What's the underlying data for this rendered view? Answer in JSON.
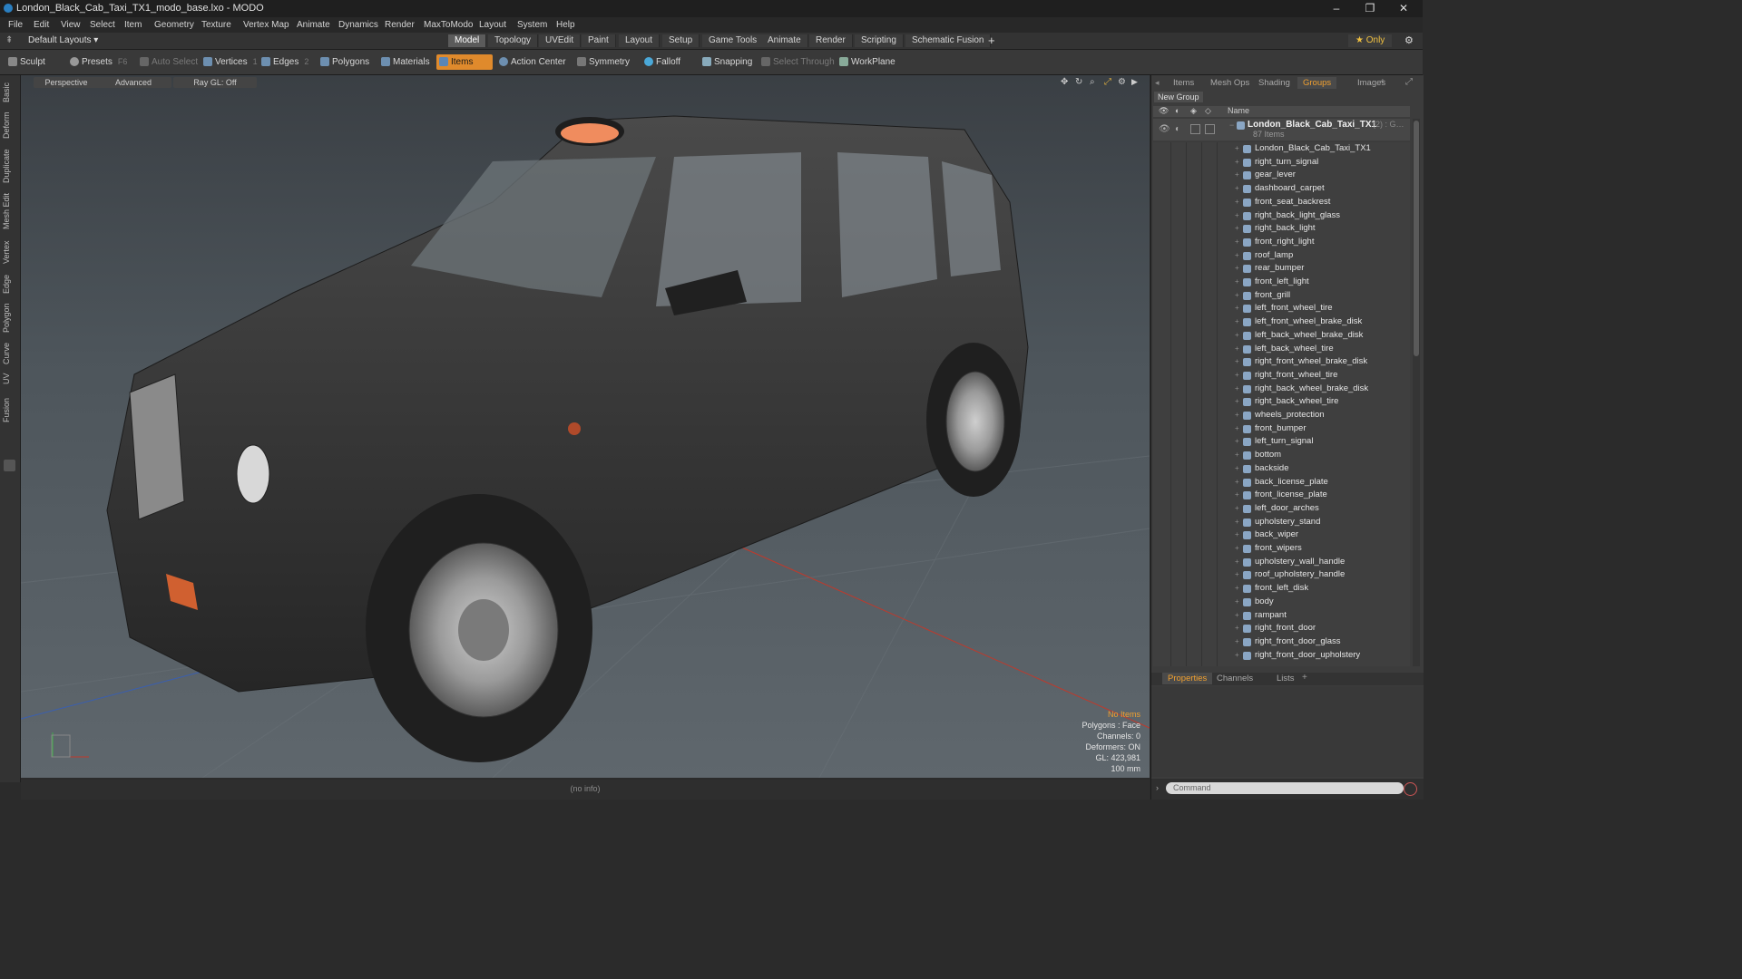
{
  "window": {
    "title": "London_Black_Cab_Taxi_TX1_modo_base.lxo - MODO",
    "controls": [
      "–",
      "❐",
      "✕"
    ]
  },
  "menu": [
    "File",
    "Edit",
    "View",
    "Select",
    "Item",
    "Geometry",
    "Texture",
    "Vertex Map",
    "Animate",
    "Dynamics",
    "Render",
    "MaxToModo",
    "Layout",
    "System",
    "Help"
  ],
  "layout_bar": {
    "layout_select": "Default Layouts ▾",
    "tabs": [
      "Model",
      "Topology",
      "UVEdit",
      "Paint",
      "Layout",
      "Setup",
      "Game Tools",
      "Animate",
      "Render",
      "Scripting",
      "Schematic Fusion"
    ],
    "active_tab": "Model",
    "add": "+",
    "only": "★  Only",
    "gear": "⚙"
  },
  "toolbar": {
    "sculpt": "Sculpt",
    "presets": "Presets",
    "presets_key": "F6",
    "auto_select": "Auto Select",
    "vertices": "Vertices",
    "vertices_count": "1",
    "edges": "Edges",
    "edges_count": "2",
    "polygons": "Polygons",
    "materials": "Materials",
    "items": "Items",
    "action_center": "Action Center",
    "symmetry": "Symmetry",
    "falloff": "Falloff",
    "snapping": "Snapping",
    "select_through": "Select Through",
    "workplane": "WorkPlane"
  },
  "left_tabs": [
    "Basic",
    "Deform",
    "Duplicate",
    "Mesh Edit",
    "Vertex",
    "Edge",
    "Polygon",
    "Curve",
    "UV",
    "Fusion"
  ],
  "viewport": {
    "view": "Perspective",
    "shading": "Advanced",
    "raygl": "Ray GL: Off",
    "hud": {
      "no_items": "No Items",
      "polygons": "Polygons : Face",
      "channels": "Channels: 0",
      "deformers": "Deformers: ON",
      "gl": "GL: 423,981",
      "unit": "100 mm"
    }
  },
  "status": "(no info)",
  "right_panel": {
    "tabs": [
      "Items",
      "Mesh Ops",
      "Shading",
      "Groups",
      "Images"
    ],
    "active_tab": "Groups",
    "new_group": "New Group",
    "col_name": "Name",
    "group_name": "London_Black_Cab_Taxi_TX1",
    "group_suffix": "(2) : G…",
    "group_count": "87 Items",
    "items": [
      "London_Black_Cab_Taxi_TX1",
      "right_turn_signal",
      "gear_lever",
      "dashboard_carpet",
      "front_seat_backrest",
      "right_back_light_glass",
      "right_back_light",
      "front_right_light",
      "roof_lamp",
      "rear_bumper",
      "front_left_light",
      "front_grill",
      "left_front_wheel_tire",
      "left_front_wheel_brake_disk",
      "left_back_wheel_brake_disk",
      "left_back_wheel_tire",
      "right_front_wheel_brake_disk",
      "right_front_wheel_tire",
      "right_back_wheel_brake_disk",
      "right_back_wheel_tire",
      "wheels_protection",
      "front_bumper",
      "left_turn_signal",
      "bottom",
      "backside",
      "back_license_plate",
      "front_license_plate",
      "left_door_arches",
      "upholstery_stand",
      "back_wiper",
      "front_wipers",
      "upholstery_wall_handle",
      "roof_upholstery_handle",
      "front_left_disk",
      "body",
      "rampant",
      "right_front_door",
      "right_front_door_glass",
      "right_front_door_upholstery"
    ],
    "bottom_tabs": [
      "Properties",
      "Channels",
      "Lists"
    ],
    "bottom_active": "Properties",
    "command_placeholder": "Command"
  }
}
